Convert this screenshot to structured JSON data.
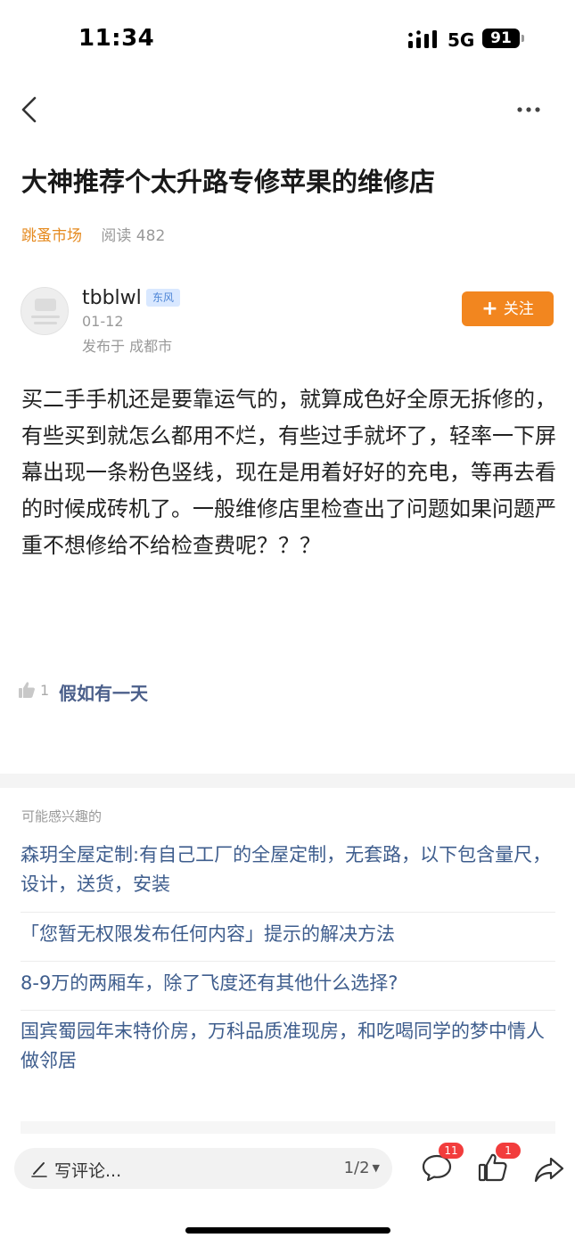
{
  "status_bar": {
    "time": "11:34",
    "network": "5G",
    "battery": "91",
    "signal_icon": "signal-bars-icon"
  },
  "nav": {
    "back_icon": "chevron-left-icon",
    "more_icon": "more-dots-icon"
  },
  "article": {
    "title": "大神推荐个太升路专修苹果的维修店",
    "forum": "跳蚤市场",
    "read_count": "阅读 482"
  },
  "author": {
    "name": "tbblwl",
    "badge": "东风",
    "date": "01-12",
    "location": "发布于 成都市",
    "follow_label": "关注",
    "follow_icon": "plus-icon"
  },
  "post": {
    "body": "买二手手机还是要靠运气的，就算成色好全原无拆修的，有些买到就怎么都用不烂，有些过手就坏了，轻率一下屏幕出现一条粉色竖线，现在是用着好好的充电，等再去看的时候成砖机了。一般维修店里检查出了问题如果问题严重不想修给不给检查费呢？？？"
  },
  "likes": {
    "count": "1",
    "liker": "假如有一天",
    "icon": "thumbs-up-icon"
  },
  "recommend": {
    "title": "可能感兴趣的",
    "items": [
      "森玥全屋定制:有自己工厂的全屋定制，无套路，以下包含量尺，设计，送货，安装",
      "「您暂无权限发布任何内容」提示的解决方法",
      "8-9万的两厢车，除了飞度还有其他什么选择?",
      "国宾蜀园年末特价房，万科品质准现房，和吃喝同学的梦中情人做邻居"
    ]
  },
  "bottom_bar": {
    "comment_placeholder": "写评论...",
    "page_indicator": "1/2",
    "comment_count": "11",
    "like_count": "1",
    "icons": [
      "pencil-icon",
      "comment-bubble-icon",
      "thumbs-up-icon",
      "share-arrow-icon"
    ]
  },
  "colors": {
    "accent": "#f2861f",
    "forum_link": "#e58a1f",
    "link_blue": "#3e5d8d",
    "badge_red": "#f23c3c"
  }
}
